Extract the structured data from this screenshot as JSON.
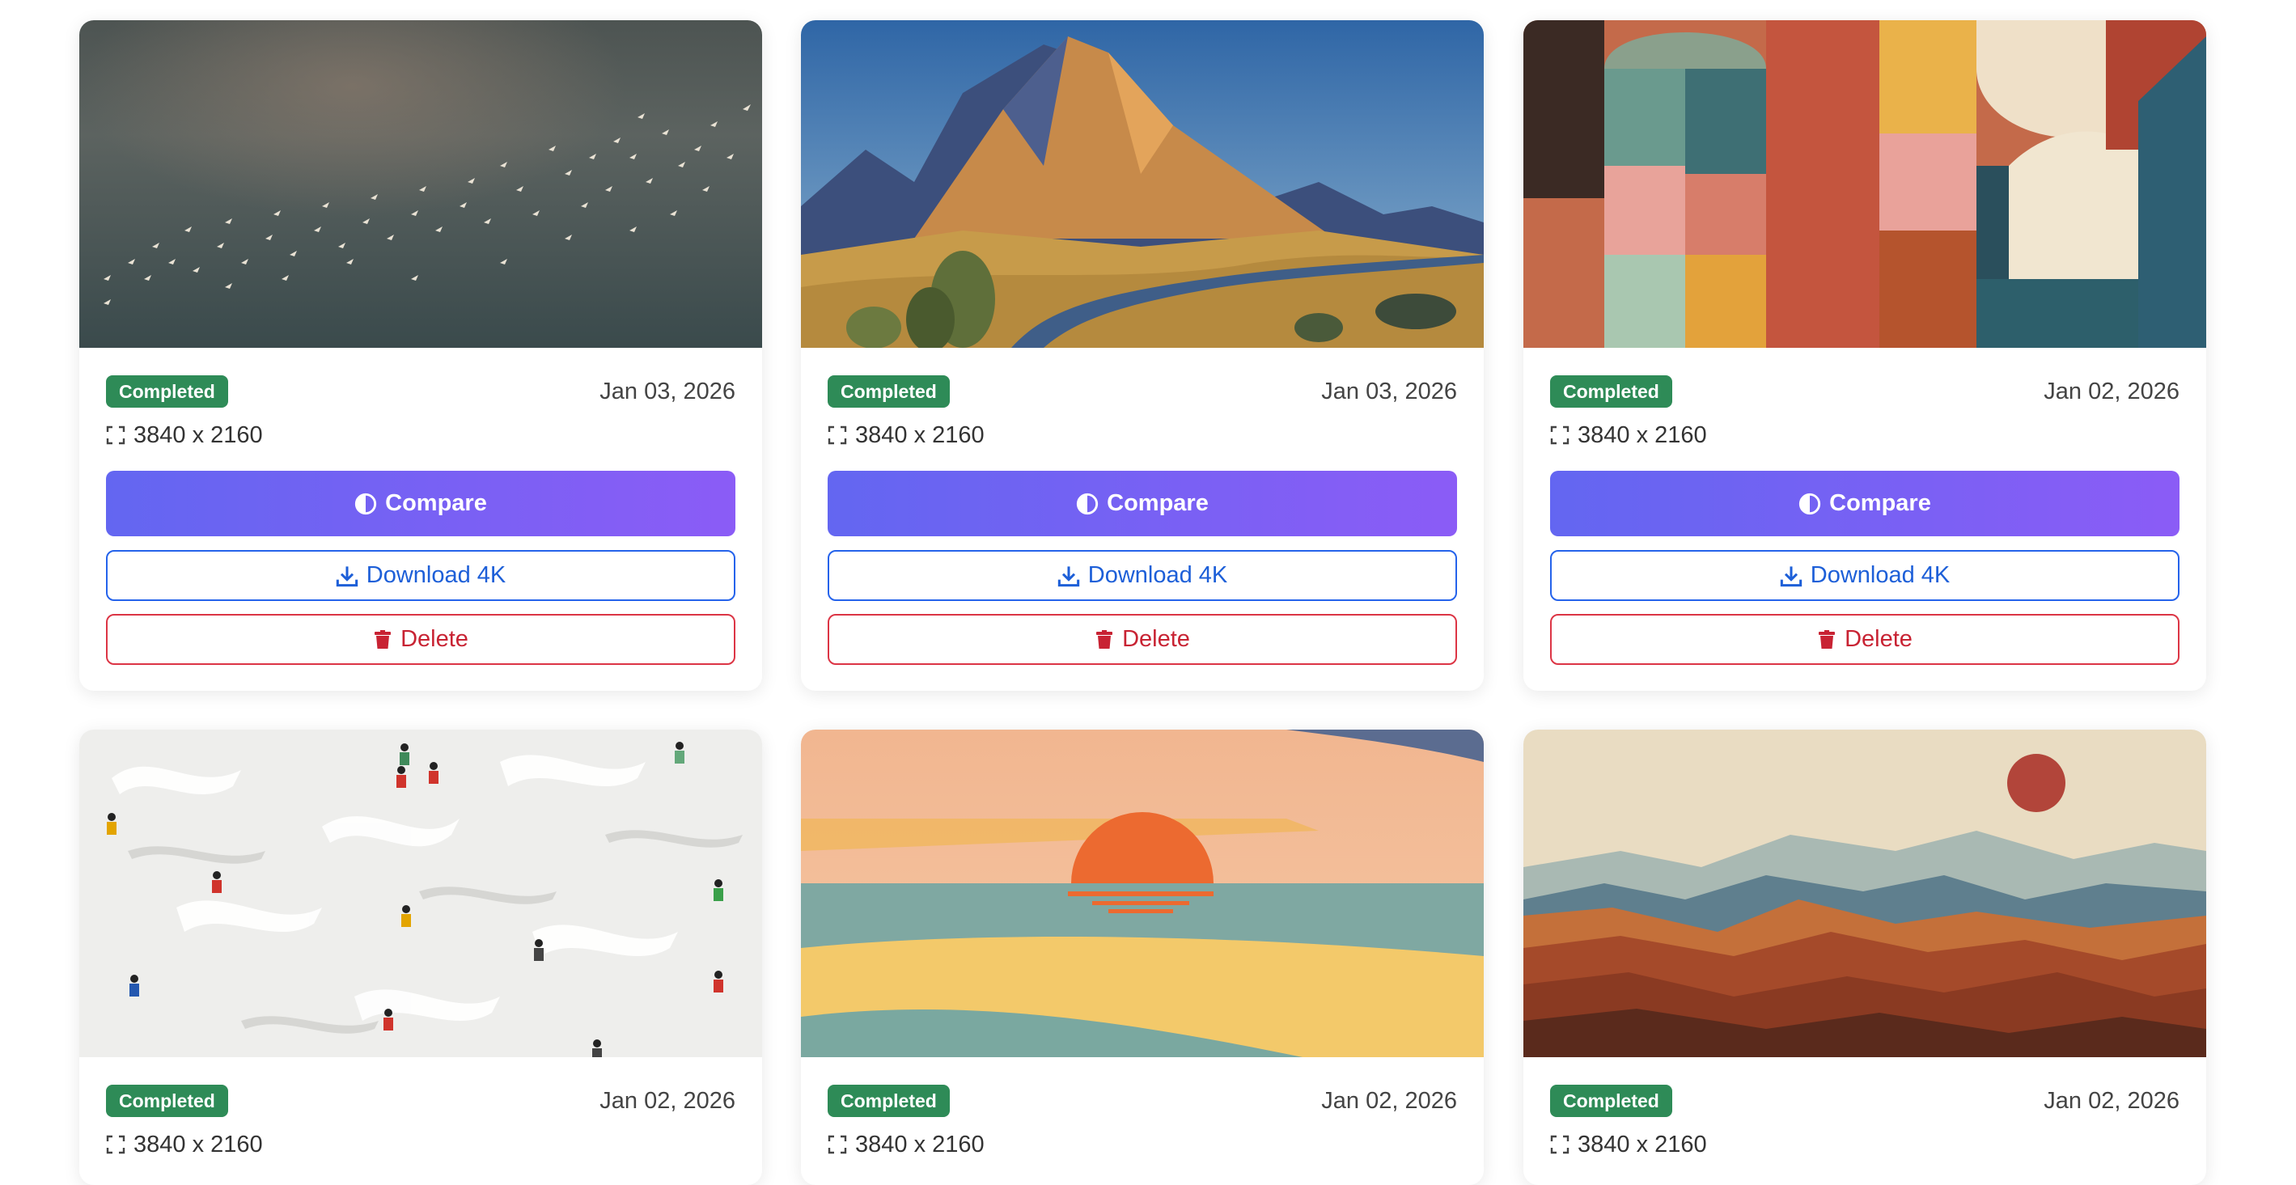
{
  "cards": [
    {
      "status": "Completed",
      "date": "Jan 03, 2026",
      "resolution": "3840 x 2160",
      "image": "birds-over-stormy-sky"
    },
    {
      "status": "Completed",
      "date": "Jan 03, 2026",
      "resolution": "3840 x 2160",
      "image": "golden-mountain-valley"
    },
    {
      "status": "Completed",
      "date": "Jan 02, 2026",
      "resolution": "3840 x 2160",
      "image": "abstract-color-blocks"
    },
    {
      "status": "Completed",
      "date": "Jan 02, 2026",
      "resolution": "3840 x 2160",
      "image": "skiers-on-white-snow"
    },
    {
      "status": "Completed",
      "date": "Jan 02, 2026",
      "resolution": "3840 x 2160",
      "image": "sunset-over-sea"
    },
    {
      "status": "Completed",
      "date": "Jan 02, 2026",
      "resolution": "3840 x 2160",
      "image": "layered-mountains-red-sun"
    }
  ],
  "buttons": {
    "compare": "Compare",
    "download": "Download 4K",
    "delete": "Delete"
  },
  "colors": {
    "status_green": "#2e8b57",
    "compare_start": "#6366f1",
    "compare_end": "#8b5cf6",
    "download_blue": "#2563eb",
    "delete_red": "#dc3545"
  },
  "icons": {
    "resolution": "fullscreen-icon",
    "compare": "half-circle-icon",
    "download": "download-icon",
    "delete": "trash-icon"
  }
}
